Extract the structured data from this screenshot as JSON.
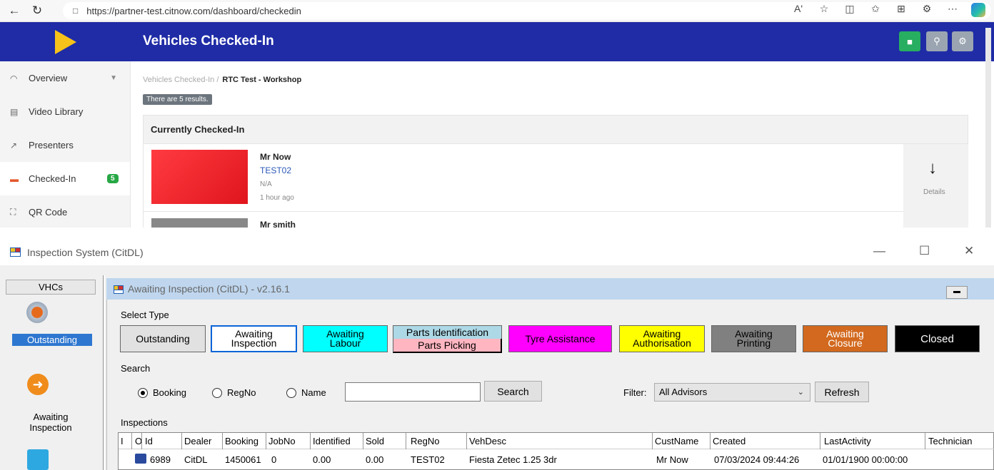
{
  "browser": {
    "url": "https://partner-test.citnow.com/dashboard/checkedin",
    "icons": [
      "back-icon",
      "refresh-icon",
      "site-info-icon",
      "read-aloud-icon",
      "favorite-icon",
      "split-screen-icon",
      "favorites-bar-icon",
      "collections-icon",
      "extensions-icon",
      "more-icon",
      "copilot-icon"
    ],
    "read_aloud": "Aʹ"
  },
  "web": {
    "heading": "Vehicles Checked-In",
    "header_buttons": [
      {
        "icon": "car-icon",
        "color": "#27ae60"
      },
      {
        "icon": "search-icon",
        "color": "#9aa5b1"
      },
      {
        "icon": "gear-icon",
        "color": "#9aa5b1"
      }
    ],
    "sidebar": [
      {
        "label": "Overview",
        "icon": "overview-icon",
        "has_chevron": true
      },
      {
        "label": "Video Library",
        "icon": "video-library-icon"
      },
      {
        "label": "Presenters",
        "icon": "presenters-icon"
      },
      {
        "label": "Checked-In",
        "icon": "car-icon",
        "badge": "5",
        "active": true
      },
      {
        "label": "QR Code",
        "icon": "qr-code-icon"
      }
    ],
    "breadcrumb": {
      "parent": "Vehicles Checked-In /",
      "current": "RTC Test - Workshop"
    },
    "results": "There are 5 results.",
    "panel_title": "Currently Checked-In",
    "vehicles": [
      {
        "name": "Mr Now",
        "reg": "TEST02",
        "desc": "N/A",
        "time": "1 hour ago",
        "thumb_color": "#e8161e"
      },
      {
        "name": "Mr smith"
      }
    ],
    "details_label": "Details"
  },
  "app": {
    "window_title": "Inspection System (CitDL)",
    "left_panel": {
      "vhcs_label": "VHCs",
      "items": [
        {
          "label": "Outstanding",
          "icon": "outstanding-icon",
          "selected": true
        },
        {
          "label": "Awaiting\nInspection",
          "icon": "arrow-right-circle-icon"
        },
        {
          "label": "",
          "icon": "cart-icon"
        }
      ]
    },
    "child_title": "Awaiting Inspection (CitDL) - v2.16.1",
    "select_type_label": "Select Type",
    "types": [
      {
        "label": "Outstanding",
        "bg": "#e1e1e1",
        "fg": "#000"
      },
      {
        "label": "Awaiting\nInspection",
        "bg": "#ffffff",
        "fg": "#000",
        "selected": true
      },
      {
        "label": "Awaiting\nLabour",
        "bg": "#00ffff",
        "fg": "#000"
      },
      {
        "label": "Parts Identification",
        "bg": "#add8e6",
        "fg": "#000"
      },
      {
        "label": "Parts Picking",
        "bg": "#ffb6c1",
        "fg": "#000"
      },
      {
        "label": "Tyre Assistance",
        "bg": "#ff00ff",
        "fg": "#000"
      },
      {
        "label": "Awaiting\nAuthorisation",
        "bg": "#ffff00",
        "fg": "#000"
      },
      {
        "label": "Awaiting\nPrinting",
        "bg": "#808080",
        "fg": "#000"
      },
      {
        "label": "Awaiting\nClosure",
        "bg": "#d2691e",
        "fg": "#fff"
      },
      {
        "label": "Closed",
        "bg": "#000000",
        "fg": "#fff"
      }
    ],
    "search_label": "Search",
    "radios": [
      {
        "label": "Booking",
        "checked": true
      },
      {
        "label": "RegNo",
        "checked": false
      },
      {
        "label": "Name",
        "checked": false
      }
    ],
    "search_value": "",
    "search_button": "Search",
    "filter_label": "Filter:",
    "filter_value": "All Advisors",
    "refresh_button": "Refresh",
    "inspections_label": "Inspections",
    "columns": [
      "I",
      "O",
      "Id",
      "Dealer",
      "Booking",
      "JobNo",
      "Identified",
      "Sold",
      "RegNo",
      "VehDesc",
      "CustName",
      "Created",
      "LastActivity",
      "Technician"
    ],
    "rows": [
      {
        "I": "",
        "O": "",
        "Id": "6989",
        "Dealer": "CitDL",
        "Booking": "1450061",
        "JobNo": "0",
        "Identified": "0.00",
        "Sold": "0.00",
        "RegNo": "TEST02",
        "VehDesc": "Fiesta Zetec 1.25 3dr",
        "CustName": "Mr Now",
        "Created": "07/03/2024 09:44:26",
        "LastActivity": "01/01/1900 00:00:00",
        "Technician": ""
      }
    ]
  }
}
